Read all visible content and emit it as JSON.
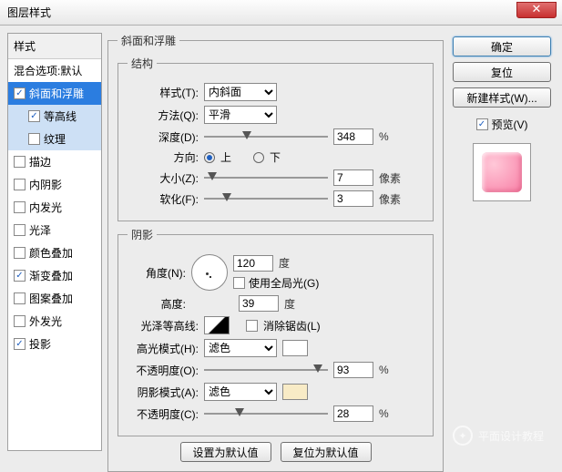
{
  "window": {
    "title": "图层样式",
    "close": "✕"
  },
  "styles": {
    "header": "样式",
    "blend": "混合选项:默认",
    "items": [
      {
        "label": "斜面和浮雕",
        "checked": true,
        "sel": true
      },
      {
        "label": "等高线",
        "checked": true,
        "sub": true,
        "hi": true
      },
      {
        "label": "纹理",
        "checked": false,
        "sub": true,
        "hi": true
      },
      {
        "label": "描边",
        "checked": false
      },
      {
        "label": "内阴影",
        "checked": false
      },
      {
        "label": "内发光",
        "checked": false
      },
      {
        "label": "光泽",
        "checked": false
      },
      {
        "label": "颜色叠加",
        "checked": false
      },
      {
        "label": "渐变叠加",
        "checked": true
      },
      {
        "label": "图案叠加",
        "checked": false
      },
      {
        "label": "外发光",
        "checked": false
      },
      {
        "label": "投影",
        "checked": true
      }
    ]
  },
  "bevel": {
    "groupTitle": "斜面和浮雕",
    "structTitle": "结构",
    "styleLabel": "样式(T):",
    "styleVal": "内斜面",
    "techLabel": "方法(Q):",
    "techVal": "平滑",
    "depthLabel": "深度(D):",
    "depthVal": "348",
    "depthUnit": "%",
    "dirLabel": "方向:",
    "upLabel": "上",
    "downLabel": "下",
    "sizeLabel": "大小(Z):",
    "sizeVal": "7",
    "sizeUnit": "像素",
    "softLabel": "软化(F):",
    "softVal": "3",
    "softUnit": "像素"
  },
  "shade": {
    "title": "阴影",
    "angleLabel": "角度(N):",
    "angleVal": "120",
    "angleUnit": "度",
    "globalLabel": "使用全局光(G)",
    "altLabel": "高度:",
    "altVal": "39",
    "altUnit": "度",
    "glossLabel": "光泽等高线:",
    "antiLabel": "消除锯齿(L)",
    "hiModeLabel": "高光模式(H):",
    "hiModeVal": "滤色",
    "hiOpLabel": "不透明度(O):",
    "hiOpVal": "93",
    "pct": "%",
    "shModeLabel": "阴影模式(A):",
    "shModeVal": "滤色",
    "shOpLabel": "不透明度(C):",
    "shOpVal": "28"
  },
  "buttons": {
    "ok": "确定",
    "cancel": "复位",
    "newStyle": "新建样式(W)...",
    "preview": "预览(V)",
    "setDefault": "设置为默认值",
    "resetDefault": "复位为默认值"
  },
  "watermark": "平面设计教程"
}
